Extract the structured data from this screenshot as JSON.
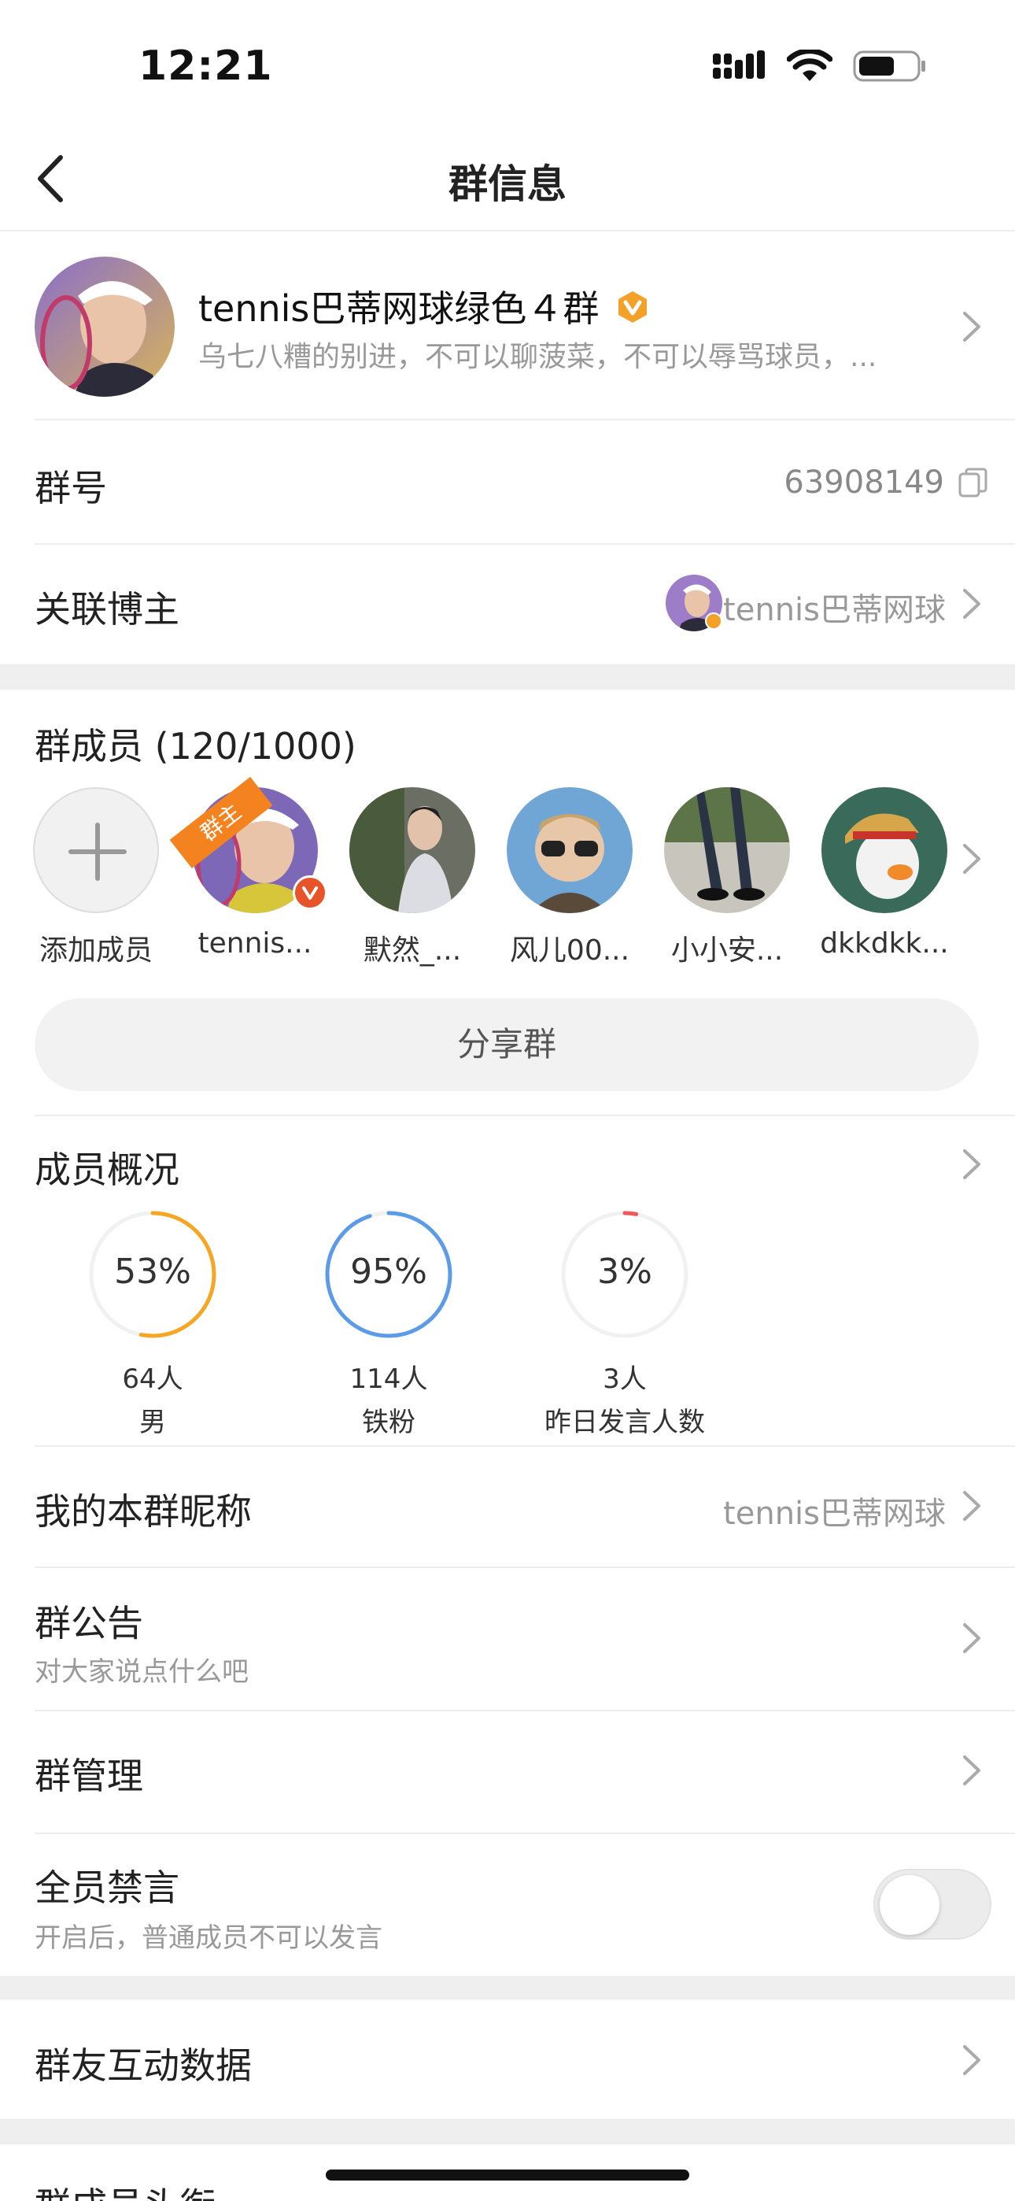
{
  "status_bar": {
    "time": "12:21"
  },
  "nav": {
    "title": "群信息"
  },
  "group": {
    "name": "tennis巴蒂网球绿色４群",
    "description": "乌七八糟的别进，不可以聊菠菜，不可以辱骂球员，..."
  },
  "group_number": {
    "label": "群号",
    "value": "63908149"
  },
  "linked_blogger": {
    "label": "关联博主",
    "name": "tennis巴蒂网球"
  },
  "members": {
    "title": "群成员 (120/1000)",
    "add_label": "添加成员",
    "owner_badge": "群主",
    "list": [
      {
        "name": "tennis..."
      },
      {
        "name": "默然_..."
      },
      {
        "name": "风儿00..."
      },
      {
        "name": "小小安..."
      },
      {
        "name": "dkkdkk..."
      }
    ],
    "share_label": "分享群"
  },
  "overview": {
    "title": "成员概况",
    "stats": [
      {
        "percent": "53%",
        "value": 53,
        "count": "64人",
        "label": "男",
        "color": "#f5a623"
      },
      {
        "percent": "95%",
        "value": 95,
        "count": "114人",
        "label": "铁粉",
        "color": "#5b9be8"
      },
      {
        "percent": "3%",
        "value": 3,
        "count": "3人",
        "label": "昨日发言人数",
        "color": "#f2575a"
      }
    ]
  },
  "nickname": {
    "label": "我的本群昵称",
    "value": "tennis巴蒂网球"
  },
  "announcement": {
    "label": "群公告",
    "sub": "对大家说点什么吧"
  },
  "management": {
    "label": "群管理"
  },
  "mute_all": {
    "label": "全员禁言",
    "sub": "开启后，普通成员不可以发言",
    "enabled": false
  },
  "interaction": {
    "label": "群友互动数据"
  },
  "member_titles": {
    "label": "群成员头衔"
  },
  "colors": {
    "accent_orange": "#f5a623",
    "blue": "#5b9be8",
    "red": "#f2575a",
    "badge_orange": "#f4831f"
  }
}
